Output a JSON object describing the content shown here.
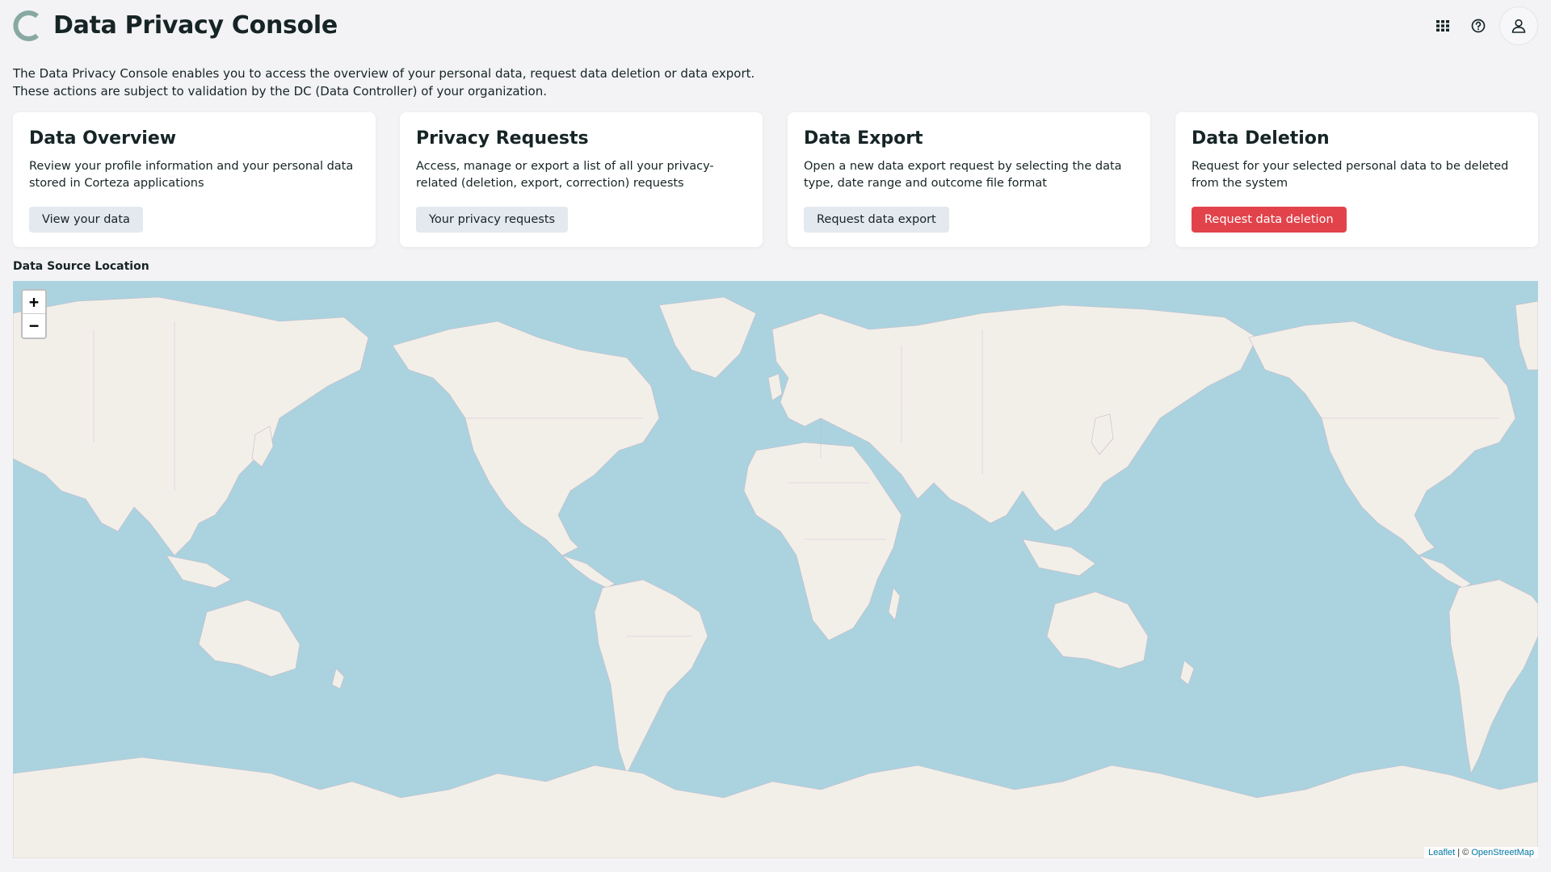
{
  "header": {
    "title": "Data Privacy Console",
    "logo_icon": "corteza-c-logo",
    "brand_color": "#88a9a1",
    "icons": [
      "apps-grid-icon",
      "help-circle-icon",
      "user-icon"
    ]
  },
  "intro": {
    "line1": "The Data Privacy Console enables you to access the overview of your personal data, request data deletion or data export.",
    "line2": "These actions are subject to validation by the DC (Data Controller) of your organization."
  },
  "cards": [
    {
      "title": "Data Overview",
      "description": "Review your profile information and your personal data stored in Corteza applications",
      "button": "View your data"
    },
    {
      "title": "Privacy Requests",
      "description": "Access, manage or export a list of all your privacy-related (deletion, export, correction) requests",
      "button": "Your privacy requests"
    },
    {
      "title": "Data Export",
      "description": "Open a new data export request by selecting the data type, date range and outcome file format",
      "button": "Request data export"
    },
    {
      "title": "Data Deletion",
      "description": "Request for your selected personal data to be deleted from the system",
      "button": "Request data deletion",
      "button_color": "#e2434b"
    }
  ],
  "map": {
    "label": "Data Source Location",
    "zoom_in": "+",
    "zoom_out": "−",
    "attribution_leaflet": "Leaflet",
    "attribution_sep": " | © ",
    "attribution_osm": "OpenStreetMap",
    "water_color": "#aad3df",
    "land_color": "#f2efe9"
  }
}
